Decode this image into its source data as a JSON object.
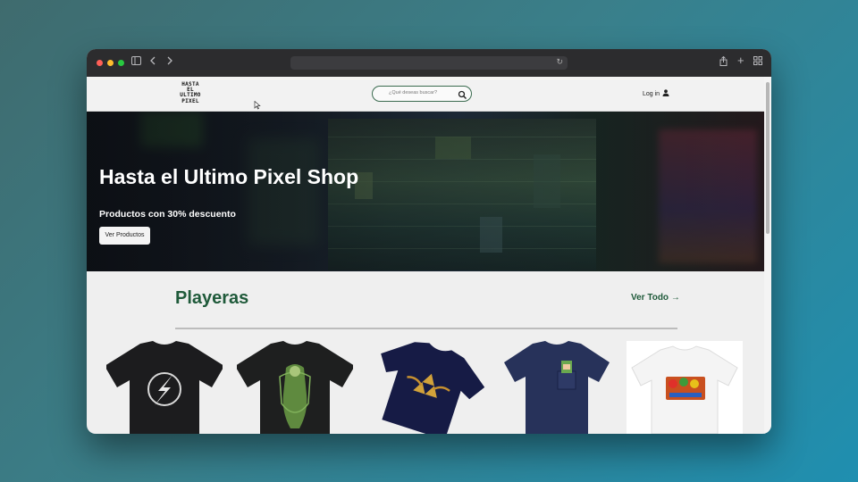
{
  "browser": {
    "url": "",
    "colors": {
      "close": "#ff5f57",
      "minimize": "#febc2e",
      "maximize": "#28c840"
    },
    "icons": [
      "sidebar-icon",
      "back-icon",
      "forward-icon",
      "reload-icon",
      "share-icon",
      "new-tab-icon",
      "tab-overview-icon"
    ]
  },
  "nav": {
    "logo_lines": [
      "HASTA",
      "EL",
      "ULTIMO",
      "PIXEL"
    ],
    "search_placeholder": "¿Qué deseas buscar?",
    "login_label": "Log in"
  },
  "hero": {
    "title": "Hasta el Ultimo Pixel Shop",
    "subtitle": "Productos con 30% descuento",
    "button_label": "Ver Productos"
  },
  "section": {
    "title": "Playeras",
    "link_label": "Ver Todo"
  },
  "products": [
    {
      "name": "flash-shirt",
      "color": "#1c1c1e"
    },
    {
      "name": "zelda-link-shirt",
      "color": "#1e1f1f"
    },
    {
      "name": "triforce-shirt",
      "color": "#161b45"
    },
    {
      "name": "link-pocket-shirt",
      "color": "#27325a"
    },
    {
      "name": "mario-kart-shirt",
      "color": "#f4f4f4"
    }
  ],
  "theme": {
    "accent": "#1f5a3a"
  }
}
